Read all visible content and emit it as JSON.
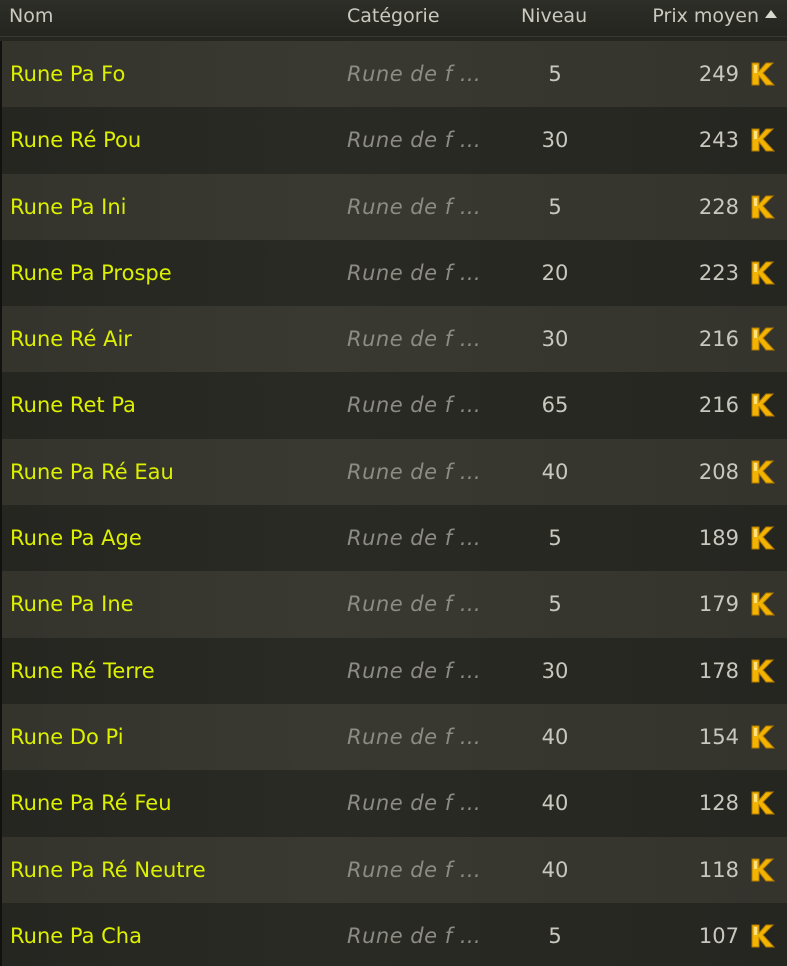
{
  "header": {
    "nom": "Nom",
    "categorie": "Catégorie",
    "niveau": "Niveau",
    "prix": "Prix moyen"
  },
  "rows": [
    {
      "nom": "Rune Pa Fo",
      "categorie": "Rune de f …",
      "niveau": "5",
      "prix": "249"
    },
    {
      "nom": "Rune Ré Pou",
      "categorie": "Rune de f …",
      "niveau": "30",
      "prix": "243"
    },
    {
      "nom": "Rune Pa Ini",
      "categorie": "Rune de f …",
      "niveau": "5",
      "prix": "228"
    },
    {
      "nom": "Rune Pa Prospe",
      "categorie": "Rune de f …",
      "niveau": "20",
      "prix": "223"
    },
    {
      "nom": "Rune Ré Air",
      "categorie": "Rune de f …",
      "niveau": "30",
      "prix": "216"
    },
    {
      "nom": "Rune Ret Pa",
      "categorie": "Rune de f …",
      "niveau": "65",
      "prix": "216"
    },
    {
      "nom": "Rune Pa Ré Eau",
      "categorie": "Rune de f …",
      "niveau": "40",
      "prix": "208"
    },
    {
      "nom": "Rune Pa Age",
      "categorie": "Rune de f …",
      "niveau": "5",
      "prix": "189"
    },
    {
      "nom": "Rune Pa Ine",
      "categorie": "Rune de f …",
      "niveau": "5",
      "prix": "179"
    },
    {
      "nom": "Rune Ré Terre",
      "categorie": "Rune de f …",
      "niveau": "30",
      "prix": "178"
    },
    {
      "nom": "Rune Do Pi",
      "categorie": "Rune de f …",
      "niveau": "40",
      "prix": "154"
    },
    {
      "nom": "Rune Pa Ré Feu",
      "categorie": "Rune de f …",
      "niveau": "40",
      "prix": "128"
    },
    {
      "nom": "Rune Pa Ré Neutre",
      "categorie": "Rune de f …",
      "niveau": "40",
      "prix": "118"
    },
    {
      "nom": "Rune Pa Cha",
      "categorie": "Rune de f …",
      "niveau": "5",
      "prix": "107"
    }
  ],
  "colors": {
    "name_text": "#dcf000",
    "category_text": "#8c8c84",
    "kama_icon": "#f2b400"
  },
  "icons": {
    "sort": "sort-ascending-icon",
    "currency": "kama-icon"
  }
}
